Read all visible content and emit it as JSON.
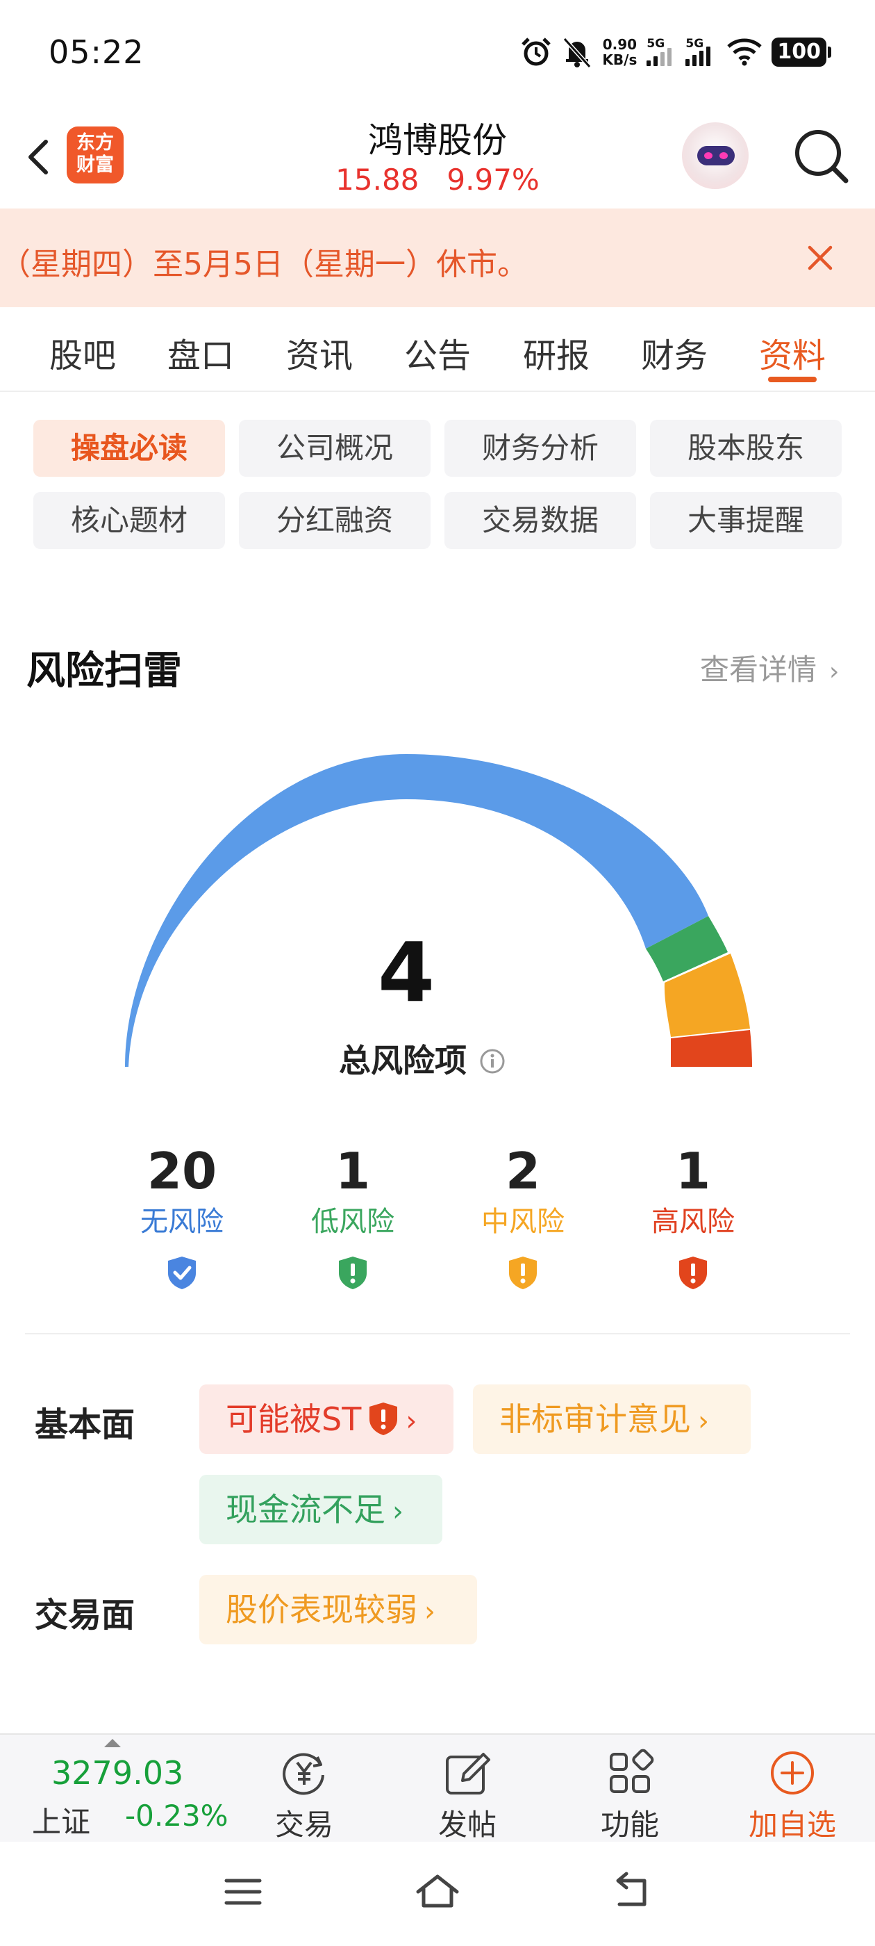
{
  "status_bar": {
    "time": "05:22",
    "net_speed_value": "0.90",
    "net_speed_unit": "KB/s",
    "sim1_label": "5G",
    "sim2_label": "5G",
    "battery": "100"
  },
  "header": {
    "logo_line1": "东方",
    "logo_line2": "财富",
    "stock_name": "鸿博股份",
    "price": "15.88",
    "change_pct": "9.97%"
  },
  "notice": {
    "text": "（星期四）至5月5日（星期一）休市。"
  },
  "tabs": [
    {
      "label": "股吧",
      "active": false
    },
    {
      "label": "盘口",
      "active": false
    },
    {
      "label": "资讯",
      "active": false
    },
    {
      "label": "公告",
      "active": false
    },
    {
      "label": "研报",
      "active": false
    },
    {
      "label": "财务",
      "active": false
    },
    {
      "label": "资料",
      "active": true
    }
  ],
  "categories": [
    {
      "label": "操盘必读",
      "active": true
    },
    {
      "label": "公司概况",
      "active": false
    },
    {
      "label": "财务分析",
      "active": false
    },
    {
      "label": "股本股东",
      "active": false
    },
    {
      "label": "核心题材",
      "active": false
    },
    {
      "label": "分红融资",
      "active": false
    },
    {
      "label": "交易数据",
      "active": false
    },
    {
      "label": "大事提醒",
      "active": false
    }
  ],
  "risk": {
    "title": "风险扫雷",
    "more_label": "查看详情",
    "total": "4",
    "total_label": "总风险项",
    "levels": [
      {
        "count": "20",
        "label": "无风险",
        "color": "#3a7bd5"
      },
      {
        "count": "1",
        "label": "低风险",
        "color": "#3aa65e"
      },
      {
        "count": "2",
        "label": "中风险",
        "color": "#f5a623"
      },
      {
        "count": "1",
        "label": "高风险",
        "color": "#e04020"
      }
    ],
    "gauge_colors": {
      "none": "#5b9be8",
      "low": "#3aa65e",
      "mid": "#f5a623",
      "high": "#e2451c"
    }
  },
  "fundamentals": {
    "label": "基本面",
    "tags": [
      {
        "label": "可能被ST",
        "tone": "red"
      },
      {
        "label": "非标审计意见",
        "tone": "amber"
      },
      {
        "label": "现金流不足",
        "tone": "green"
      }
    ]
  },
  "trading": {
    "label": "交易面",
    "tags": [
      {
        "label": "股价表现较弱",
        "tone": "amber"
      }
    ]
  },
  "toolbar": {
    "index_value": "3279.03",
    "index_name": "上证",
    "index_change": "-0.23%",
    "trade_label": "交易",
    "post_label": "发帖",
    "functions_label": "功能",
    "add_watch_label": "加自选"
  }
}
